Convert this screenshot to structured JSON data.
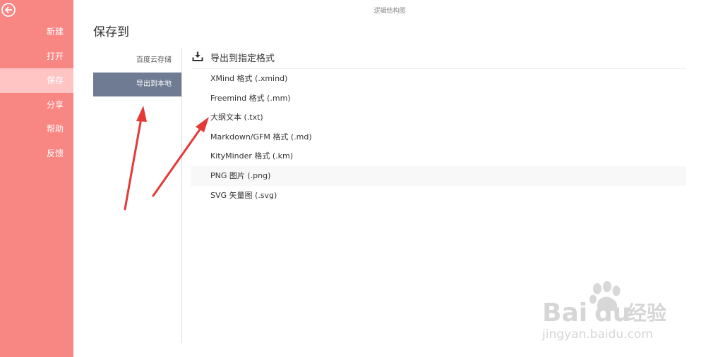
{
  "window": {
    "title": "逻辑结构图"
  },
  "sidebar": {
    "items": [
      {
        "label": "新建",
        "active": false
      },
      {
        "label": "打开",
        "active": false
      },
      {
        "label": "保存",
        "active": true
      },
      {
        "label": "分享",
        "active": false
      },
      {
        "label": "帮助",
        "active": false
      },
      {
        "label": "反馈",
        "active": false
      }
    ]
  },
  "page": {
    "title": "保存到"
  },
  "save_menu": {
    "items": [
      {
        "label": "百度云存储",
        "active": false
      },
      {
        "label": "导出到本地",
        "active": true
      }
    ]
  },
  "export": {
    "section_title": "导出到指定格式",
    "formats": [
      {
        "label": "XMind 格式 (.xmind)"
      },
      {
        "label": "Freemind 格式 (.mm)"
      },
      {
        "label": "大纲文本 (.txt)"
      },
      {
        "label": "Markdown/GFM 格式 (.md)"
      },
      {
        "label": "KityMinder 格式 (.km)"
      },
      {
        "label": "PNG 图片 (.png)"
      },
      {
        "label": "SVG 矢量图 (.svg)"
      }
    ]
  },
  "watermark": {
    "brand": "Bai",
    "brand2": "du",
    "cn": "经验",
    "url": "jingyan.baidu.com"
  },
  "colors": {
    "sidebar": "#f88683",
    "sidebar_active": "#ffc4c4",
    "submenu_active": "#6e7b93",
    "annotation": "#e53935"
  }
}
